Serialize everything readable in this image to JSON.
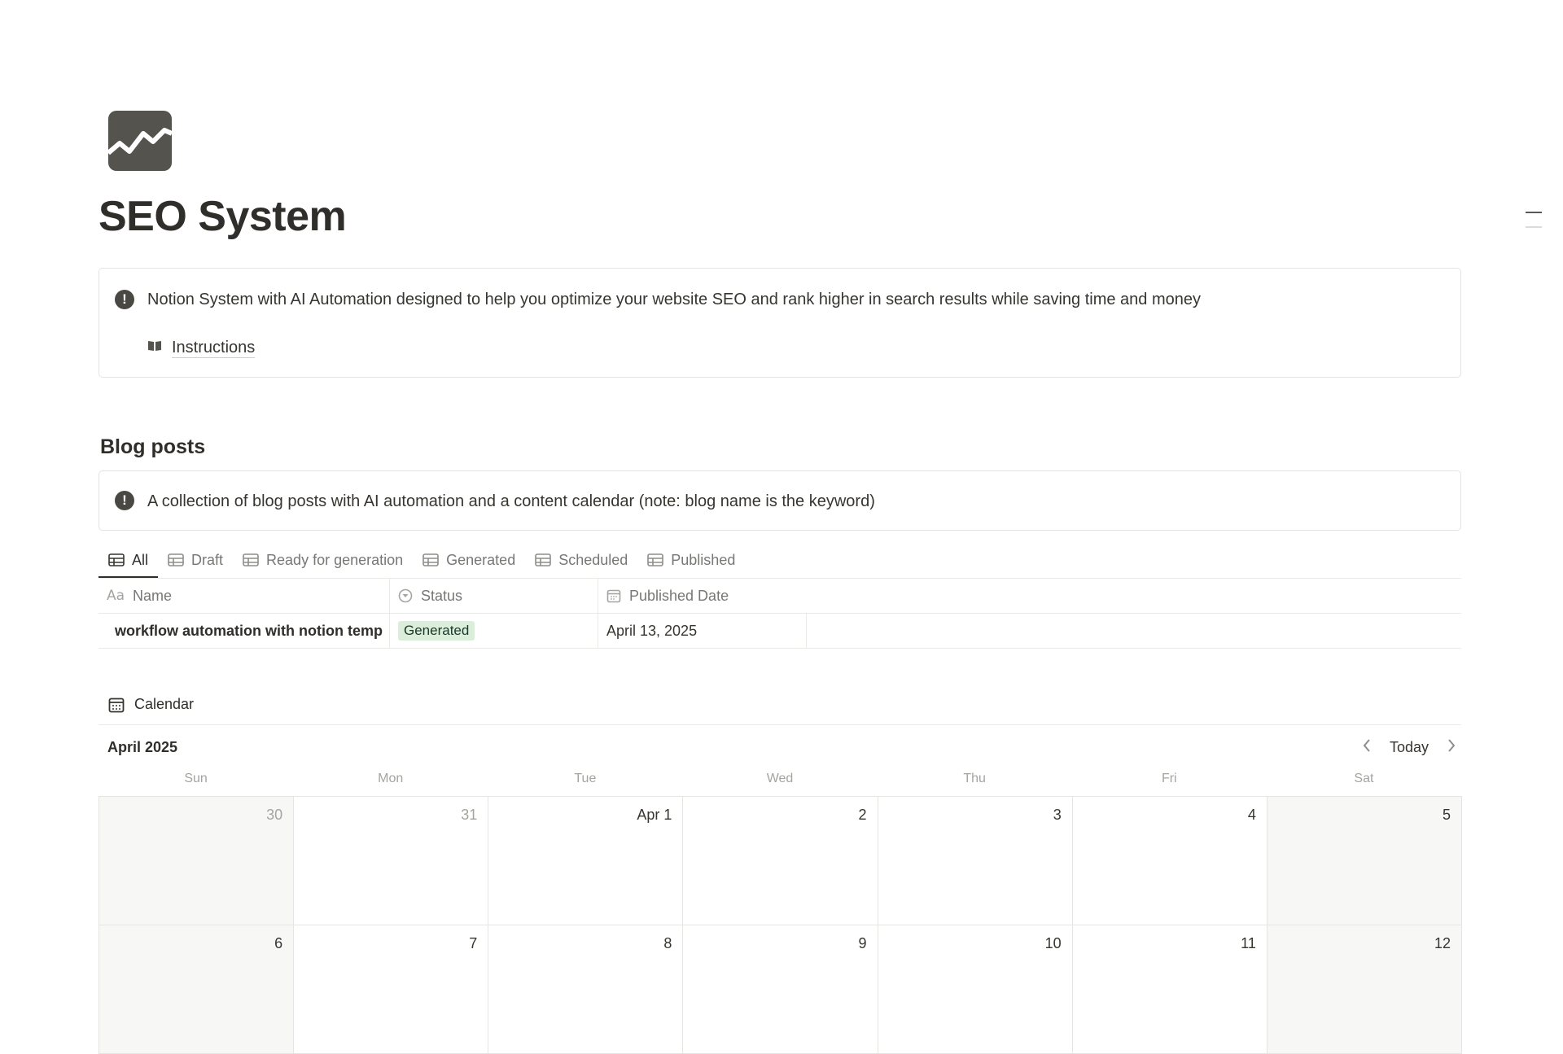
{
  "page": {
    "icon": "trend-line-icon",
    "title": "SEO System"
  },
  "intro_callout": {
    "icon": "exclamation-icon",
    "text": "Notion System with AI Automation designed to help you optimize your website SEO and rank higher in search results while saving time and money",
    "link": {
      "icon": "book-icon",
      "label": "Instructions"
    }
  },
  "blog": {
    "title": "Blog posts",
    "callout": {
      "icon": "exclamation-icon",
      "text": "A collection of blog posts with AI automation and a content calendar (note: blog name is the keyword)"
    },
    "tabs": [
      {
        "label": "All",
        "icon": "table-icon",
        "active": true
      },
      {
        "label": "Draft",
        "icon": "table-icon"
      },
      {
        "label": "Ready for generation",
        "icon": "table-icon"
      },
      {
        "label": "Generated",
        "icon": "table-icon"
      },
      {
        "label": "Scheduled",
        "icon": "table-icon"
      },
      {
        "label": "Published",
        "icon": "table-icon"
      }
    ],
    "table": {
      "columns": [
        {
          "label": "Name",
          "icon": "Aa"
        },
        {
          "label": "Status",
          "icon": "status-icon"
        },
        {
          "label": "Published Date",
          "icon": "calendar-icon"
        }
      ],
      "rows": [
        {
          "name": "workflow automation with notion temp",
          "status": "Generated",
          "status_color": "#dbeddb",
          "published_date": "April 13, 2025"
        }
      ]
    }
  },
  "calendar": {
    "view_label": "Calendar",
    "month": "April 2025",
    "today_label": "Today",
    "weekdays": [
      "Sun",
      "Mon",
      "Tue",
      "Wed",
      "Thu",
      "Fri",
      "Sat"
    ],
    "weeks": [
      [
        "30",
        "31",
        "Apr 1",
        "2",
        "3",
        "4",
        "5"
      ],
      [
        "6",
        "7",
        "8",
        "9",
        "10",
        "11",
        "12"
      ]
    ]
  },
  "colors": {
    "text": "#37352f",
    "muted": "#787774",
    "badge_generated": "#dbeddb",
    "weekend_shade": "#f7f7f5"
  }
}
